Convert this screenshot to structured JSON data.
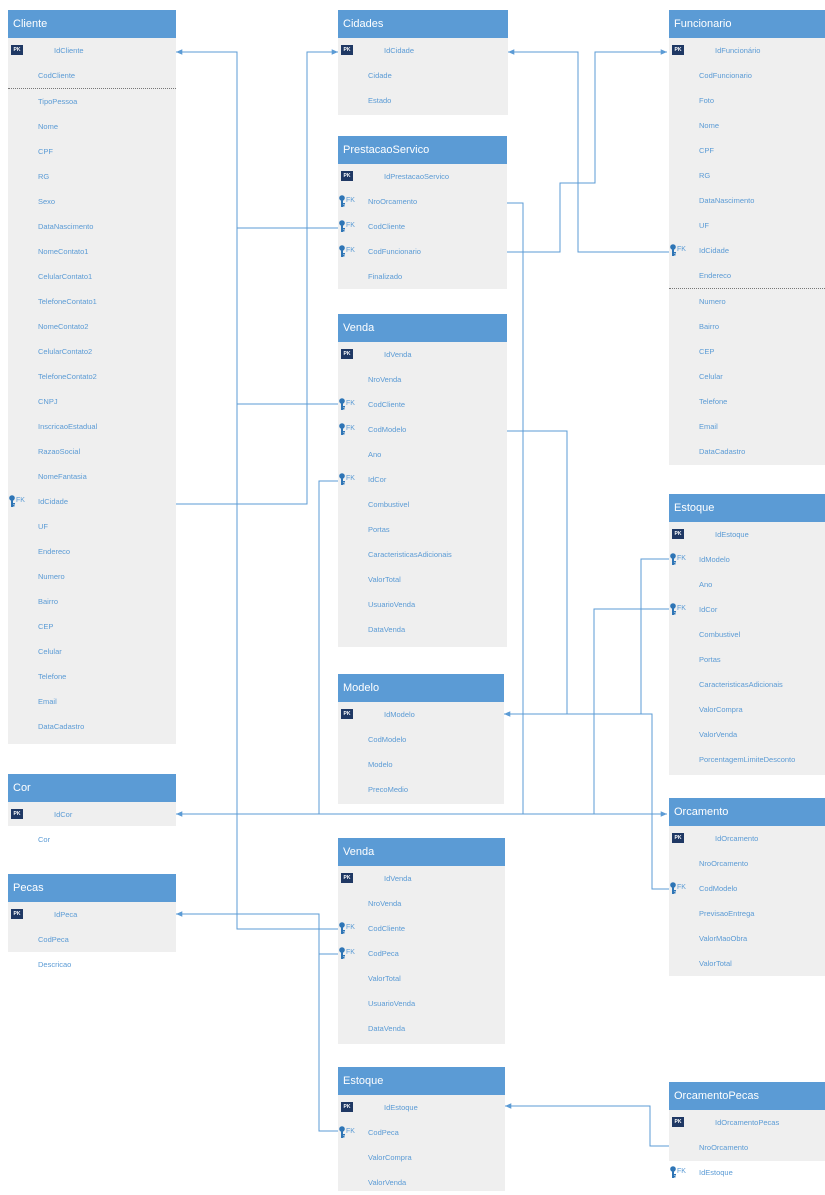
{
  "entities": {
    "cliente": {
      "title": "Cliente",
      "rows": [
        {
          "label": "IdCliente",
          "badge": "PK"
        },
        {
          "label": "CodCliente"
        },
        {
          "label": "TipoPessoa"
        },
        {
          "label": "Nome"
        },
        {
          "label": "CPF"
        },
        {
          "label": "RG"
        },
        {
          "label": "Sexo"
        },
        {
          "label": "DataNascimento"
        },
        {
          "label": "NomeContato1"
        },
        {
          "label": "CelularContato1"
        },
        {
          "label": "TelefoneContato1"
        },
        {
          "label": "NomeContato2"
        },
        {
          "label": "CelularContato2"
        },
        {
          "label": "TelefoneContato2"
        },
        {
          "label": "CNPJ"
        },
        {
          "label": "InscricaoEstadual"
        },
        {
          "label": "RazaoSocial"
        },
        {
          "label": "NomeFantasia"
        },
        {
          "label": "IdCidade",
          "badge": "FK"
        },
        {
          "label": "UF"
        },
        {
          "label": "Endereco"
        },
        {
          "label": "Numero"
        },
        {
          "label": "Bairro"
        },
        {
          "label": "CEP"
        },
        {
          "label": "Celular"
        },
        {
          "label": "Telefone"
        },
        {
          "label": "Email"
        },
        {
          "label": "DataCadastro"
        }
      ]
    },
    "cor": {
      "title": "Cor",
      "rows": [
        {
          "label": "IdCor",
          "badge": "PK"
        },
        {
          "label": "Cor"
        }
      ]
    },
    "pecas": {
      "title": "Pecas",
      "rows": [
        {
          "label": "IdPeca",
          "badge": "PK"
        },
        {
          "label": "CodPeca"
        },
        {
          "label": "Descricao"
        }
      ]
    },
    "cidades": {
      "title": "Cidades",
      "rows": [
        {
          "label": "IdCidade",
          "badge": "PK"
        },
        {
          "label": "Cidade"
        },
        {
          "label": "Estado"
        }
      ]
    },
    "prestacao": {
      "title": "PrestacaoServico",
      "rows": [
        {
          "label": "IdPrestacaoServico",
          "badge": "PK"
        },
        {
          "label": "NroOrcamento",
          "badge": "FK"
        },
        {
          "label": "CodCliente",
          "badge": "FK"
        },
        {
          "label": "CodFuncionario",
          "badge": "FK"
        },
        {
          "label": "Finalizado"
        }
      ]
    },
    "venda1": {
      "title": "Venda",
      "rows": [
        {
          "label": "IdVenda",
          "badge": "PK"
        },
        {
          "label": "NroVenda"
        },
        {
          "label": "CodCliente",
          "badge": "FK"
        },
        {
          "label": "CodModelo",
          "badge": "FK"
        },
        {
          "label": "Ano"
        },
        {
          "label": "IdCor",
          "badge": "FK"
        },
        {
          "label": "Combustivel"
        },
        {
          "label": "Portas"
        },
        {
          "label": "CaracteristicasAdicionais"
        },
        {
          "label": "ValorTotal"
        },
        {
          "label": "UsuarioVenda"
        },
        {
          "label": "DataVenda"
        }
      ]
    },
    "modelo": {
      "title": "Modelo",
      "rows": [
        {
          "label": "IdModelo",
          "badge": "PK"
        },
        {
          "label": "CodModelo"
        },
        {
          "label": "Modelo"
        },
        {
          "label": "PrecoMedio"
        }
      ]
    },
    "venda2": {
      "title": "Venda",
      "rows": [
        {
          "label": "IdVenda",
          "badge": "PK"
        },
        {
          "label": "NroVenda"
        },
        {
          "label": "CodCliente",
          "badge": "FK"
        },
        {
          "label": "CodPeca",
          "badge": "FK"
        },
        {
          "label": "ValorTotal"
        },
        {
          "label": "UsuarioVenda"
        },
        {
          "label": "DataVenda"
        }
      ]
    },
    "estoque2": {
      "title": "Estoque",
      "rows": [
        {
          "label": "IdEstoque",
          "badge": "PK"
        },
        {
          "label": "CodPeca",
          "badge": "FK"
        },
        {
          "label": "ValorCompra"
        },
        {
          "label": "ValorVenda"
        }
      ]
    },
    "funcionario": {
      "title": "Funcionario",
      "rows": [
        {
          "label": "IdFuncionário",
          "badge": "PK"
        },
        {
          "label": "CodFuncionario"
        },
        {
          "label": "Foto"
        },
        {
          "label": "Nome"
        },
        {
          "label": "CPF"
        },
        {
          "label": "RG"
        },
        {
          "label": "DataNascimento"
        },
        {
          "label": "UF"
        },
        {
          "label": "IdCidade",
          "badge": "FK"
        },
        {
          "label": "Endereco"
        },
        {
          "label": "Numero"
        },
        {
          "label": "Bairro"
        },
        {
          "label": "CEP"
        },
        {
          "label": "Celular"
        },
        {
          "label": "Telefone"
        },
        {
          "label": "Email"
        },
        {
          "label": "DataCadastro"
        }
      ]
    },
    "estoque1": {
      "title": "Estoque",
      "rows": [
        {
          "label": "IdEstoque",
          "badge": "PK"
        },
        {
          "label": "IdModelo",
          "badge": "FK"
        },
        {
          "label": "Ano"
        },
        {
          "label": "IdCor",
          "badge": "FK"
        },
        {
          "label": "Combustivel"
        },
        {
          "label": "Portas"
        },
        {
          "label": "CaracteristicasAdicionais"
        },
        {
          "label": "ValorCompra"
        },
        {
          "label": "ValorVenda"
        },
        {
          "label": "PorcentagemLimiteDesconto"
        }
      ]
    },
    "orcamento": {
      "title": "Orcamento",
      "rows": [
        {
          "label": "IdOrcamento",
          "badge": "PK"
        },
        {
          "label": "NroOrcamento"
        },
        {
          "label": "CodModelo",
          "badge": "FK"
        },
        {
          "label": "PrevisaoEntrega"
        },
        {
          "label": "ValorMaoObra"
        },
        {
          "label": "ValorTotal"
        }
      ]
    },
    "orcamentoPecas": {
      "title": "OrcamentoPecas",
      "rows": [
        {
          "label": "IdOrcamentoPecas",
          "badge": "PK"
        },
        {
          "label": "NroOrcamento"
        },
        {
          "label": "IdEstoque",
          "badge": "FK"
        }
      ]
    }
  },
  "colors": {
    "header": "#5b9bd5",
    "body": "#efefef",
    "text": "#5b9bd5",
    "pk_badge": "#1f3864",
    "key_icon": "#2e75b6",
    "line": "#5b9bd5"
  },
  "icons": {
    "primary_key": "pk-badge",
    "foreign_key": "key-icon"
  }
}
